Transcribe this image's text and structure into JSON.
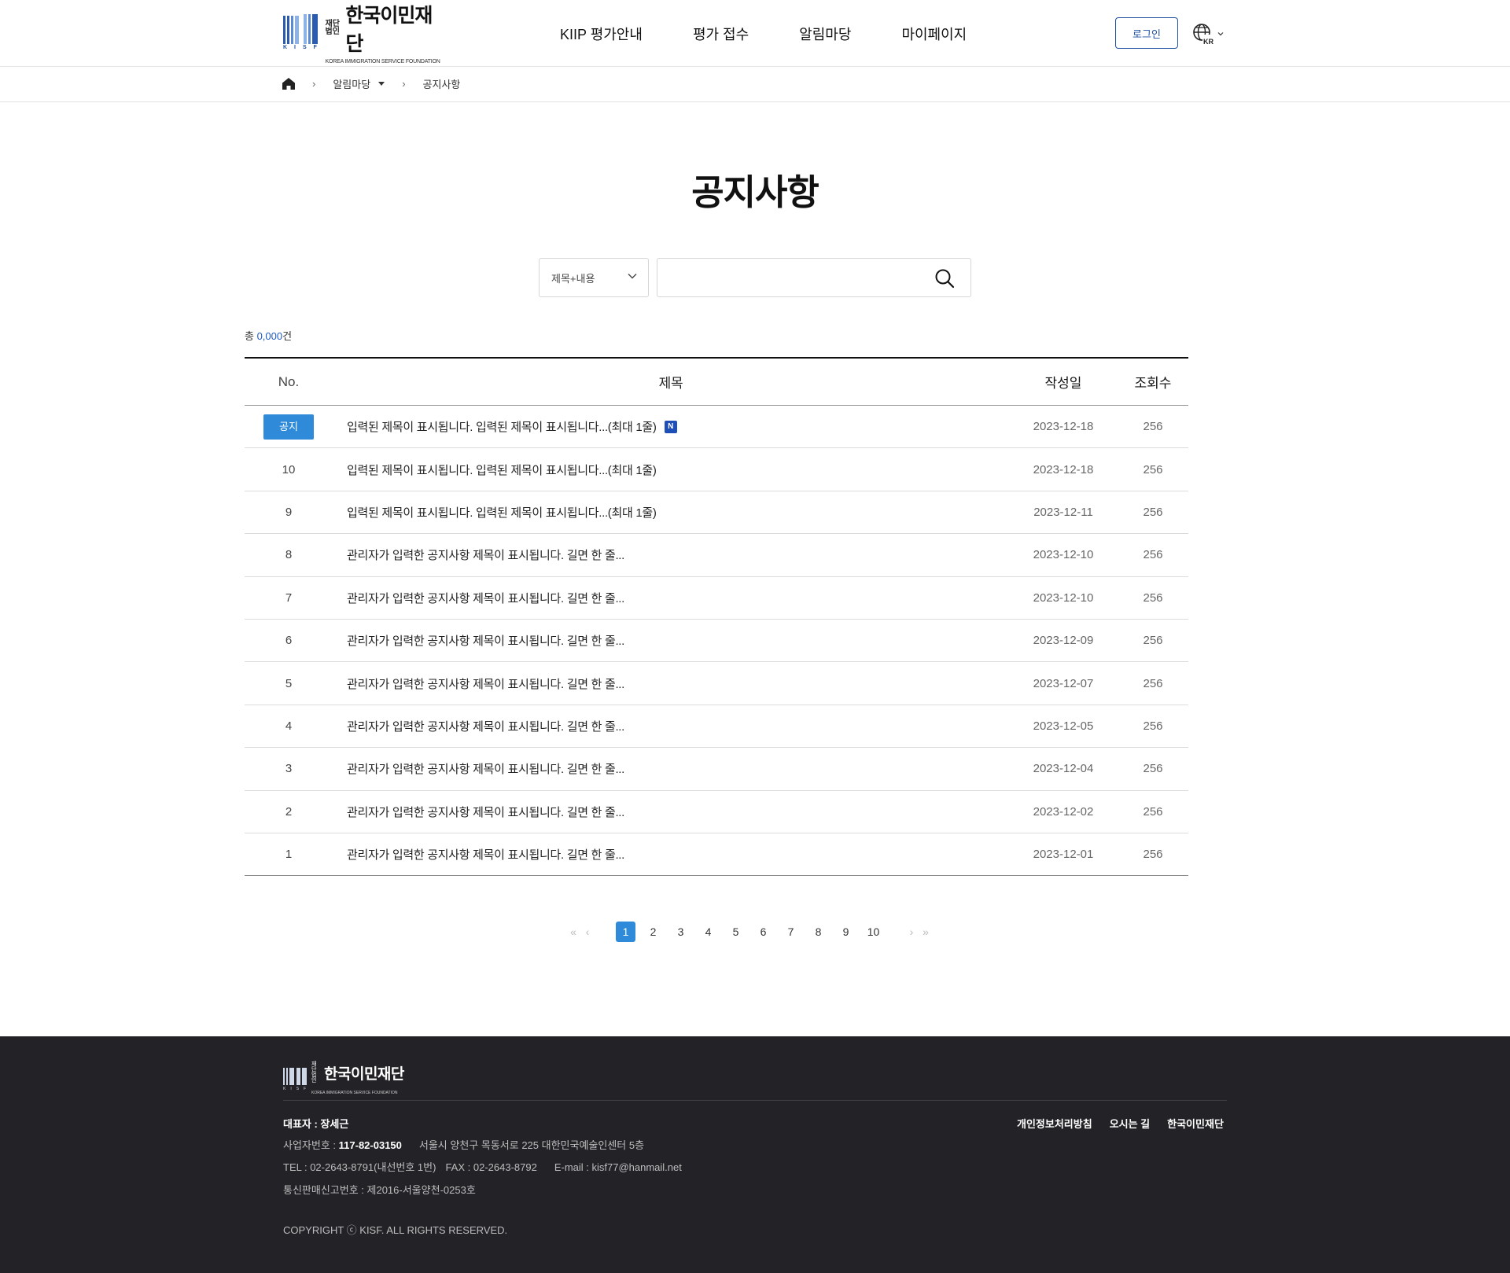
{
  "header": {
    "logo": {
      "corp": "재단법인",
      "name": "한국이민재단",
      "eng": "KOREA IMMIGRATION SERVICE FOUNDATION",
      "mark": "KISF"
    },
    "nav": [
      "KIIP 평가안내",
      "평가 접수",
      "알림마당",
      "마이페이지"
    ],
    "login_label": "로그인",
    "lang_label": "KR"
  },
  "breadcrumb": {
    "section": "알림마당",
    "current": "공지사항"
  },
  "page_title": "공지사항",
  "search": {
    "select_value": "제목+내용",
    "query": ""
  },
  "total": {
    "prefix": "총 ",
    "count": "0,000",
    "suffix": "건"
  },
  "table": {
    "headers": {
      "no": "No.",
      "title": "제목",
      "date": "작성일",
      "views": "조회수"
    },
    "rows": [
      {
        "no": "공지",
        "notice": true,
        "title": "입력된 제목이 표시됩니다. 입력된 제목이 표시됩니다...(최대 1줄)",
        "is_new": true,
        "new_label": "N",
        "date": "2023-12-18",
        "views": "256"
      },
      {
        "no": "10",
        "title": "입력된 제목이 표시됩니다. 입력된 제목이 표시됩니다...(최대 1줄)",
        "date": "2023-12-18",
        "views": "256"
      },
      {
        "no": "9",
        "title": "입력된 제목이 표시됩니다. 입력된 제목이 표시됩니다...(최대 1줄)",
        "date": "2023-12-11",
        "views": "256"
      },
      {
        "no": "8",
        "title": "관리자가 입력한 공지사항 제목이 표시됩니다. 길면 한 줄...",
        "date": "2023-12-10",
        "views": "256"
      },
      {
        "no": "7",
        "title": "관리자가 입력한 공지사항 제목이 표시됩니다. 길면 한 줄...",
        "date": "2023-12-10",
        "views": "256"
      },
      {
        "no": "6",
        "title": "관리자가 입력한 공지사항 제목이 표시됩니다. 길면 한 줄...",
        "date": "2023-12-09",
        "views": "256"
      },
      {
        "no": "5",
        "title": "관리자가 입력한 공지사항 제목이 표시됩니다. 길면 한 줄...",
        "date": "2023-12-07",
        "views": "256"
      },
      {
        "no": "4",
        "title": "관리자가 입력한 공지사항 제목이 표시됩니다. 길면 한 줄...",
        "date": "2023-12-05",
        "views": "256"
      },
      {
        "no": "3",
        "title": "관리자가 입력한 공지사항 제목이 표시됩니다. 길면 한 줄...",
        "date": "2023-12-04",
        "views": "256"
      },
      {
        "no": "2",
        "title": "관리자가 입력한 공지사항 제목이 표시됩니다. 길면 한 줄...",
        "date": "2023-12-02",
        "views": "256"
      },
      {
        "no": "1",
        "title": "관리자가 입력한 공지사항 제목이 표시됩니다. 길면 한 줄...",
        "date": "2023-12-01",
        "views": "256"
      }
    ]
  },
  "pagination": {
    "current": "1",
    "pages": [
      "1",
      "2",
      "3",
      "4",
      "5",
      "6",
      "7",
      "8",
      "9",
      "10"
    ]
  },
  "footer": {
    "ceo": "대표자 : 장세근",
    "biz_label": "사업자번호 : ",
    "biz_no": "117-82-03150",
    "address": "서울시 양천구 목동서로 225 대한민국예술인센터 5층",
    "tel": "TEL : 02-2643-8791(내선번호 1번)",
    "fax": "FAX : 02-2643-8792",
    "email": "E-mail : kisf77@hanmail.net",
    "mail_order": "통신판매신고번호 : 제2016-서울양천-0253호",
    "copyright": "COPYRIGHT ⓒ KISF. ALL RIGHTS RESERVED.",
    "links": [
      "개인정보처리방침",
      "오시는 길",
      "한국이민재단"
    ]
  },
  "colors": {
    "accent": "#2f8bd9",
    "brand": "#1e4fa0",
    "footer_bg": "#232327"
  }
}
